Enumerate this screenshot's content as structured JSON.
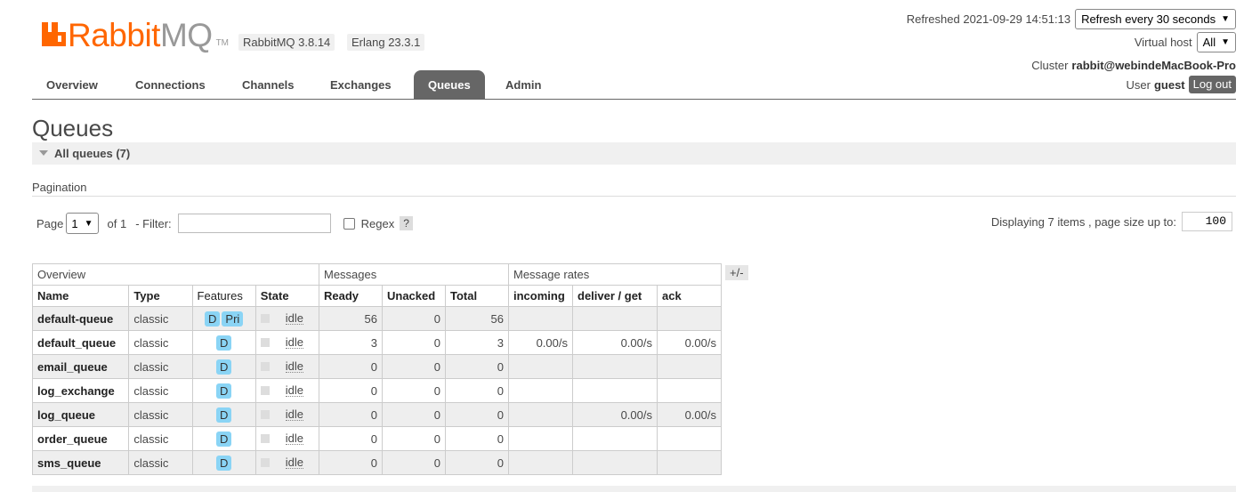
{
  "header": {
    "logo_rabbit": "Rabbit",
    "logo_mq": "MQ",
    "logo_tm": "TM",
    "rabbitmq_version": "RabbitMQ 3.8.14",
    "erlang_version": "Erlang 23.3.1",
    "brand_color": "#ff6600"
  },
  "top_right": {
    "refreshed_label": "Refreshed 2021-09-29 14:51:13",
    "refresh_select": "Refresh every 30 seconds",
    "vhost_label": "Virtual host",
    "vhost_select": "All",
    "cluster_label": "Cluster",
    "cluster_name": "rabbit@webindeMacBook-Pro",
    "user_label": "User",
    "user_name": "guest",
    "logout_label": "Log out"
  },
  "nav": {
    "tabs": [
      {
        "label": "Overview"
      },
      {
        "label": "Connections"
      },
      {
        "label": "Channels"
      },
      {
        "label": "Exchanges"
      },
      {
        "label": "Queues",
        "active": true
      },
      {
        "label": "Admin"
      }
    ]
  },
  "page": {
    "title": "Queues",
    "section_label": "All queues (7)",
    "pagination_label": "Pagination",
    "page_label": "Page",
    "page_value": "1",
    "of_label": "of 1",
    "filter_label": "- Filter:",
    "filter_value": "",
    "regex_label": "Regex",
    "help_label": "?",
    "displaying_label": "Displaying 7 items , page size up to:",
    "page_size": "100",
    "plus_minus": "+/-"
  },
  "table": {
    "groups": [
      "Overview",
      "Messages",
      "Message rates"
    ],
    "columns": [
      "Name",
      "Type",
      "Features",
      "State",
      "Ready",
      "Unacked",
      "Total",
      "incoming",
      "deliver / get",
      "ack"
    ],
    "rows": [
      {
        "name": "default-queue",
        "type": "classic",
        "features": [
          "D",
          "Pri"
        ],
        "state": "idle",
        "ready": "56",
        "unacked": "0",
        "total": "56",
        "incoming": "",
        "deliver_get": "",
        "ack": ""
      },
      {
        "name": "default_queue",
        "type": "classic",
        "features": [
          "D"
        ],
        "state": "idle",
        "ready": "3",
        "unacked": "0",
        "total": "3",
        "incoming": "0.00/s",
        "deliver_get": "0.00/s",
        "ack": "0.00/s"
      },
      {
        "name": "email_queue",
        "type": "classic",
        "features": [
          "D"
        ],
        "state": "idle",
        "ready": "0",
        "unacked": "0",
        "total": "0",
        "incoming": "",
        "deliver_get": "",
        "ack": ""
      },
      {
        "name": "log_exchange",
        "type": "classic",
        "features": [
          "D"
        ],
        "state": "idle",
        "ready": "0",
        "unacked": "0",
        "total": "0",
        "incoming": "",
        "deliver_get": "",
        "ack": ""
      },
      {
        "name": "log_queue",
        "type": "classic",
        "features": [
          "D"
        ],
        "state": "idle",
        "ready": "0",
        "unacked": "0",
        "total": "0",
        "incoming": "",
        "deliver_get": "0.00/s",
        "ack": "0.00/s"
      },
      {
        "name": "order_queue",
        "type": "classic",
        "features": [
          "D"
        ],
        "state": "idle",
        "ready": "0",
        "unacked": "0",
        "total": "0",
        "incoming": "",
        "deliver_get": "",
        "ack": ""
      },
      {
        "name": "sms_queue",
        "type": "classic",
        "features": [
          "D"
        ],
        "state": "idle",
        "ready": "0",
        "unacked": "0",
        "total": "0",
        "incoming": "",
        "deliver_get": "",
        "ack": ""
      }
    ]
  }
}
